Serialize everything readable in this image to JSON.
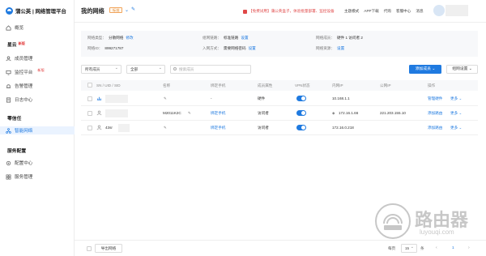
{
  "app": {
    "logo_text": "蒲公英 | 网络管理平台"
  },
  "sidebar": {
    "overview": "概览",
    "group_xingyun": "星云",
    "group_xingyun_tag": "新版",
    "member_mgmt": "成员管理",
    "monitor_platform": "监控平台",
    "monitor_tag": "新版",
    "alarm_mgmt": "告警管理",
    "log_center": "日志中心",
    "group_zhanghu": "零信任",
    "smart_network": "智能网络",
    "group_service": "服务配置",
    "config_center": "配置中心",
    "service_mgmt": "服务管理"
  },
  "header": {
    "title": "我的网络",
    "version_badge": "标准",
    "promo": "【免费试用】蒲公英盒子，体验批量部署、监控设备",
    "links": [
      "主题模式",
      "APP下载",
      "代购",
      "客服中心",
      "消息"
    ]
  },
  "info": {
    "net_type_label": "网络类型：",
    "net_type_value": "分散网络",
    "net_type_action": "修改",
    "net_id_label": "网络ID：",
    "net_id_value": "899271787",
    "net_link_label": "组网链路：",
    "net_link_value": "标准链路",
    "net_link_action": "设置",
    "join_label": "入网方式：",
    "join_value": "需要网络密码",
    "join_action": "设置",
    "member_label": "网络成员：",
    "member_value": "硬件 1   访问者 2",
    "resource_label": "网络资源：",
    "resource_action": "设置"
  },
  "toolbar": {
    "filter_type": "所有成员",
    "filter_status": "全部",
    "search_placeholder": "搜索成员",
    "add_member": "添加成员",
    "network_settings": "组网设置"
  },
  "table": {
    "headers": [
      "SN / UID / SID",
      "名称",
      "绑定手机",
      "成员属性",
      "VPN状态",
      "内网IP",
      "公网IP",
      "操作"
    ],
    "rows": [
      {
        "name": "",
        "phone": "-",
        "attr": "硬件",
        "lan_ip": "10.168.1.1",
        "wan_ip": "",
        "action_main": "管理硬件",
        "action_more": "更多"
      },
      {
        "name": "M2011K2C",
        "phone": "绑定手机",
        "attr": "访问者",
        "lan_ip": "172.16.1.66",
        "wan_ip": "221.203.155.10",
        "action_main": "添加路由",
        "action_more": "更多"
      },
      {
        "sn": "43sr",
        "name": "",
        "phone": "绑定手机",
        "attr": "访问者",
        "lan_ip": "172.16.0.218",
        "wan_ip": "",
        "action_main": "添加路由",
        "action_more": "更多"
      }
    ]
  },
  "footer": {
    "export": "导出网络",
    "page_size_label": "每页",
    "page_size": "15",
    "page_unit": "条",
    "current_page": "1"
  },
  "watermark": {
    "text_cn": "路由器",
    "text_en": "luyouqi.com"
  },
  "colors": {
    "accent": "#1f7ae0",
    "danger": "#e04848"
  }
}
